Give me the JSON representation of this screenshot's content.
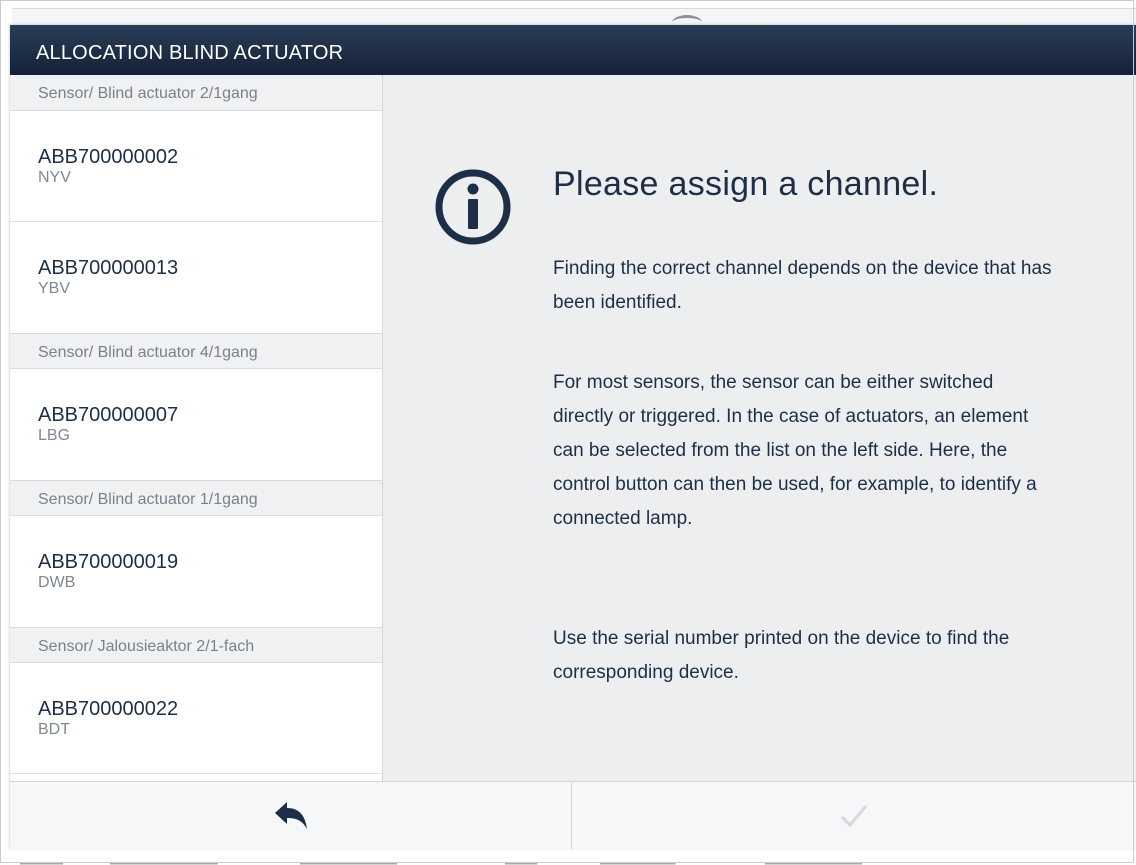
{
  "dialog": {
    "title": "ALLOCATION BLIND ACTUATOR"
  },
  "sidebar": {
    "groups": [
      {
        "header": "Sensor/ Blind actuator 2/1gang",
        "devices": [
          {
            "id": "ABB700000002",
            "code": "NYV"
          },
          {
            "id": "ABB700000013",
            "code": "YBV"
          }
        ]
      },
      {
        "header": "Sensor/ Blind actuator 4/1gang",
        "devices": [
          {
            "id": "ABB700000007",
            "code": "LBG"
          }
        ]
      },
      {
        "header": "Sensor/ Blind actuator 1/1gang",
        "devices": [
          {
            "id": "ABB700000019",
            "code": "DWB"
          }
        ]
      },
      {
        "header": "Sensor/ Jalousieaktor 2/1-fach",
        "devices": [
          {
            "id": "ABB700000022",
            "code": "BDT"
          }
        ]
      }
    ]
  },
  "content": {
    "icon": "info-circle-icon",
    "headline": "Please assign a channel.",
    "paragraph1": "Finding the correct channel depends on the device that has been identified.",
    "paragraph2": "For most sensors, the sensor can be either switched directly or triggered. In the case of actuators, an element can be selected from the list on the left side. Here, the control button can then be used, for example, to identify a connected lamp.",
    "paragraph3": "Use the serial number printed on the device to find the corresponding device."
  },
  "footer": {
    "back_icon": "back-arrow-icon",
    "confirm_icon": "checkmark-icon",
    "confirm_enabled": false
  },
  "colors": {
    "titlebar": "#1b2b42",
    "text": "#1d2f46",
    "panel": "#eceef0"
  }
}
